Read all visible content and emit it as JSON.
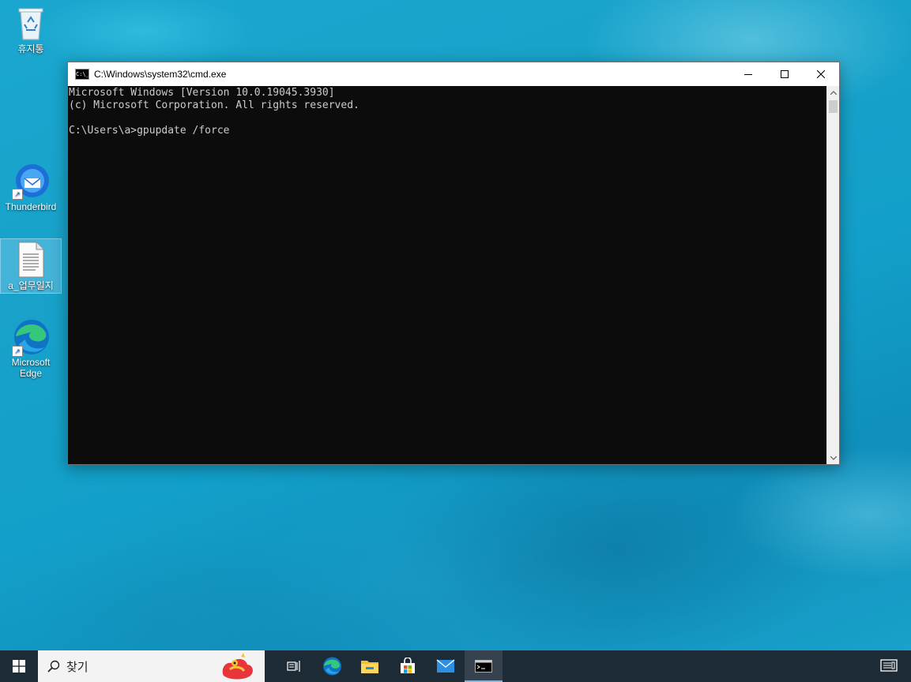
{
  "desktop": {
    "icons": [
      {
        "label": "휴지통",
        "icon": "recycle-bin-icon"
      },
      {
        "label": "Thunderbird",
        "icon": "thunderbird-icon"
      },
      {
        "label": "a_업무일지",
        "icon": "text-document-icon"
      },
      {
        "label": "Microsoft Edge",
        "icon": "edge-icon"
      }
    ]
  },
  "cmd_window": {
    "title": "C:\\Windows\\system32\\cmd.exe",
    "icon_glyph": "C:\\_",
    "lines": [
      "Microsoft Windows [Version 10.0.19045.3930]",
      "(c) Microsoft Corporation. All rights reserved.",
      "",
      "C:\\Users\\a>gpupdate /force"
    ]
  },
  "taskbar": {
    "search_placeholder": "찾기",
    "apps": [
      "task-view-icon",
      "edge-icon",
      "file-explorer-icon",
      "microsoft-store-icon",
      "mail-icon",
      "command-prompt-icon"
    ],
    "active_app": "command-prompt-icon"
  },
  "colors": {
    "console_bg": "#0c0c0c",
    "console_fg": "#cccccc",
    "taskbar_bg": "#1d2b36"
  }
}
